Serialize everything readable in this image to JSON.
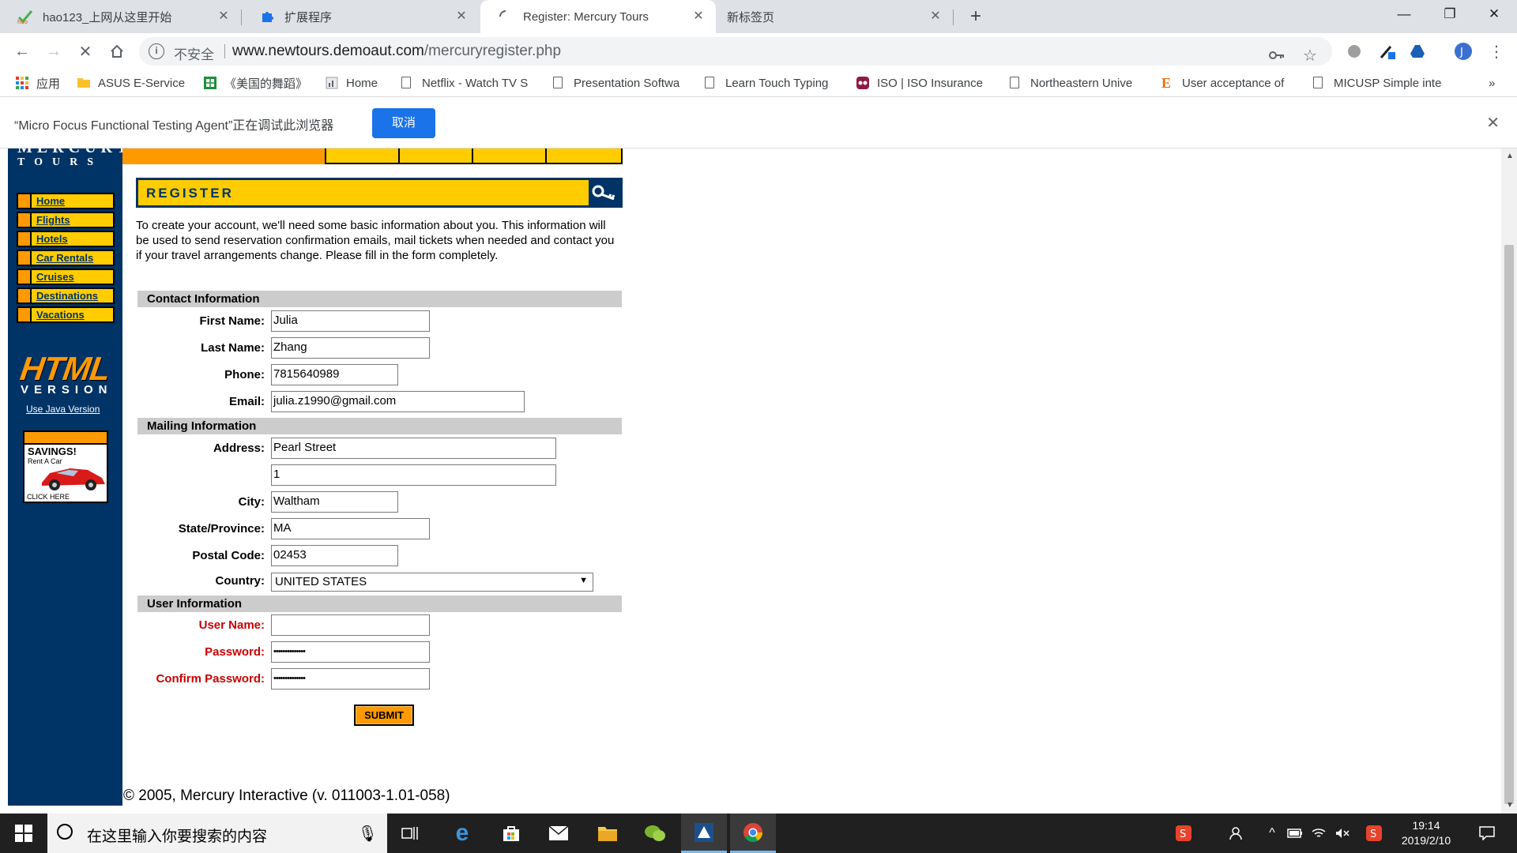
{
  "browser": {
    "tabs": [
      {
        "title": "hao123_上网从这里开始",
        "active": false
      },
      {
        "title": "扩展程序",
        "active": false
      },
      {
        "title": "Register: Mercury Tours",
        "active": true
      },
      {
        "title": "新标签页",
        "active": false
      }
    ],
    "security_label": "不安全",
    "url_domain": "www.newtours.demoaut.com",
    "url_path": "/mercuryregister.php",
    "bookmarks": [
      {
        "label": "应用"
      },
      {
        "label": "ASUS E-Service"
      },
      {
        "label": "《美国的舞蹈》"
      },
      {
        "label": "Home"
      },
      {
        "label": "Netflix - Watch TV S"
      },
      {
        "label": "Presentation Softwa"
      },
      {
        "label": "Learn Touch Typing"
      },
      {
        "label": "ISO | ISO Insurance"
      },
      {
        "label": "Northeastern Unive"
      },
      {
        "label": "User acceptance of"
      },
      {
        "label": "MICUSP Simple inte"
      }
    ],
    "bookmarks_more": "»",
    "infobar_text": "“Micro Focus Functional Testing Agent”正在调试此浏览器",
    "infobar_cancel": "取消"
  },
  "site": {
    "logo_line1": "MERCURY",
    "logo_line2": "TOURS",
    "nav": [
      "Home",
      "Flights",
      "Hotels",
      "Car Rentals",
      "Cruises",
      "Destinations",
      "Vacations"
    ],
    "html_logo_big": "HTML",
    "html_logo_small": "VERSION",
    "java_link": "Use Java Version",
    "ad_title": "SAVINGS!",
    "ad_sub": "Rent A Car",
    "ad_cta": "CLICK HERE"
  },
  "form": {
    "banner": "REGISTER",
    "intro": "To create your account, we'll need some basic information about you. This information will be used to send reservation confirmation emails, mail tickets when needed and contact you if your travel arrangements change. Please fill in the form completely.",
    "sections": {
      "contact": "Contact Information",
      "mailing": "Mailing Information",
      "user": "User Information"
    },
    "labels": {
      "first_name": "First Name:",
      "last_name": "Last Name:",
      "phone": "Phone:",
      "email": "Email:",
      "address": "Address:",
      "city": "City:",
      "state": "State/Province:",
      "postal": "Postal Code:",
      "country": "Country:",
      "username": "User Name:",
      "password": "Password:",
      "confirm_password": "Confirm Password:"
    },
    "values": {
      "first_name": "Julia",
      "last_name": "Zhang",
      "phone": "7815640989",
      "email": "julia.z1990@gmail.com",
      "address1": "Pearl Street",
      "address2": "1",
      "city": "Waltham",
      "state": "MA",
      "postal": "02453",
      "country": "UNITED STATES",
      "username": "",
      "password": "••••••••••••••",
      "confirm_password": "••••••••••••••"
    },
    "submit": "SUBMIT"
  },
  "footer": "© 2005, Mercury Interactive (v. 011003-1.01-058)",
  "taskbar": {
    "search_placeholder": "在这里输入你要搜索的内容",
    "time": "19:14",
    "date": "2019/2/10"
  }
}
